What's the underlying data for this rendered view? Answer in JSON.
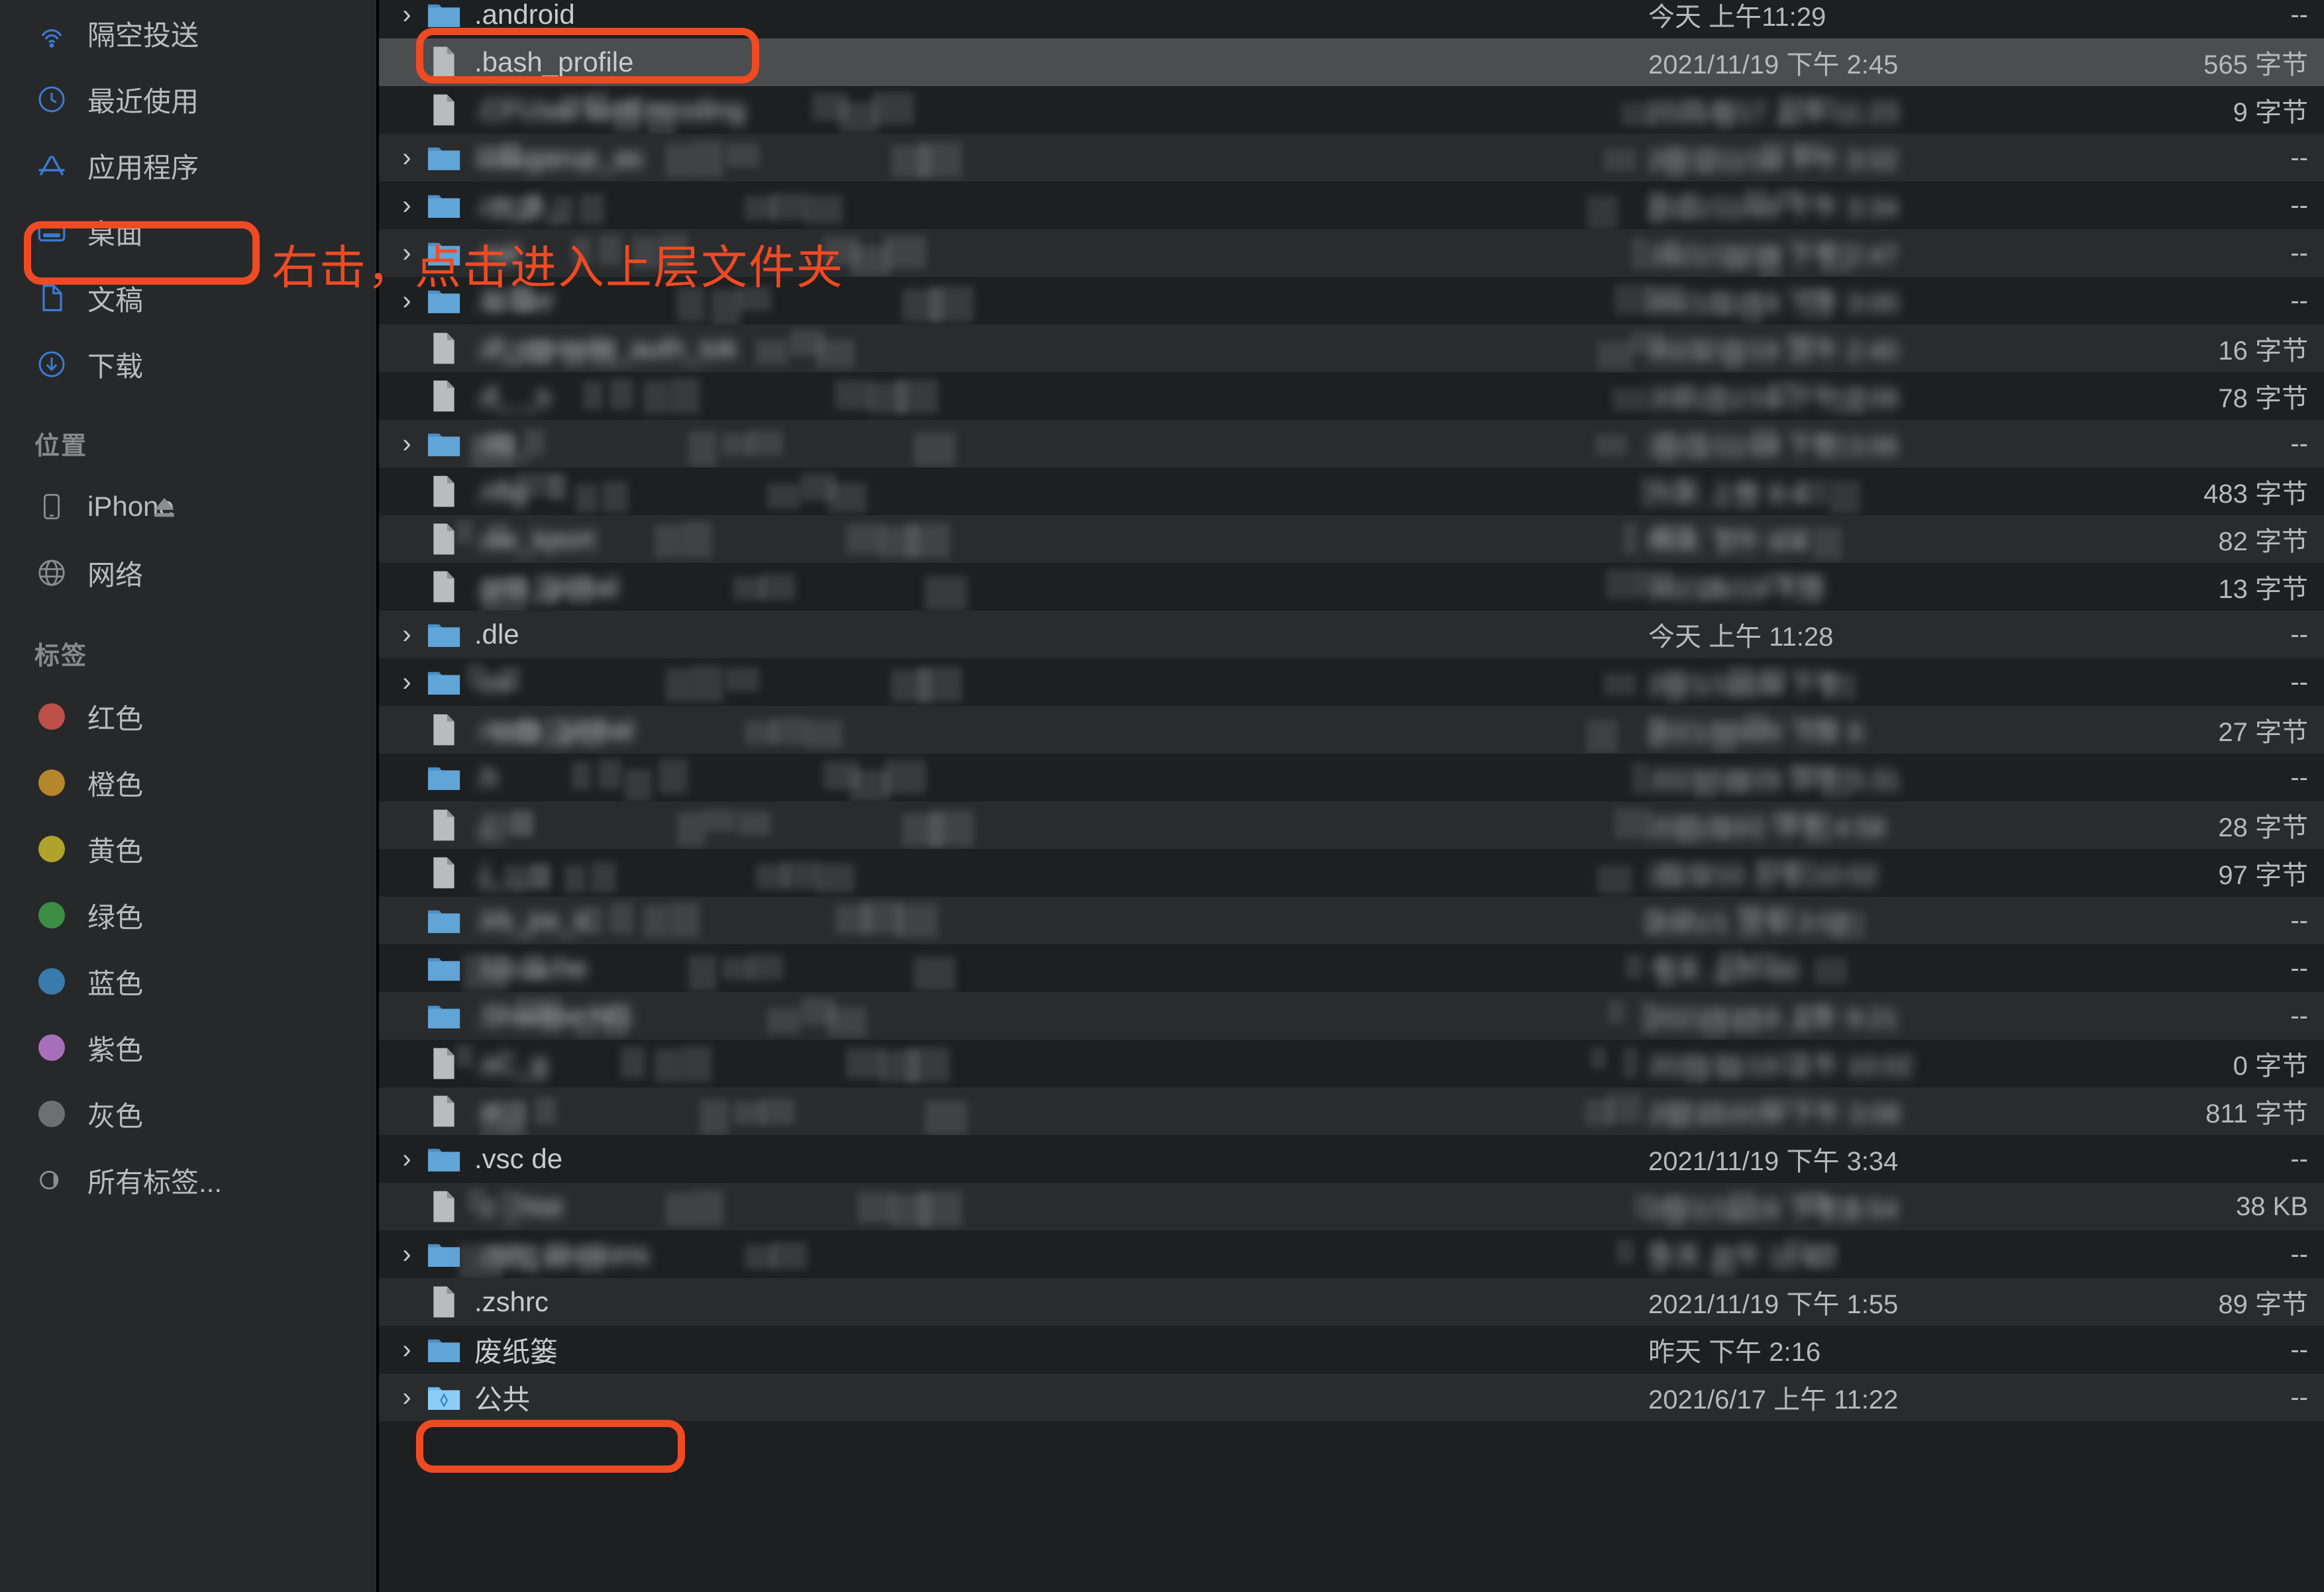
{
  "sidebar": {
    "favorites": [
      {
        "label": "隔空投送",
        "icon": "airdrop-icon"
      },
      {
        "label": "最近使用",
        "icon": "clock-icon"
      },
      {
        "label": "应用程序",
        "icon": "applications-icon"
      },
      {
        "label": "桌面",
        "icon": "desktop-icon"
      },
      {
        "label": "文稿",
        "icon": "document-icon"
      },
      {
        "label": "下载",
        "icon": "download-icon"
      }
    ],
    "locations_title": "位置",
    "locations": [
      {
        "label": "iPhone",
        "icon": "iphone-icon",
        "eject": true
      },
      {
        "label": "网络",
        "icon": "network-globe-icon",
        "eject": false
      }
    ],
    "tags_title": "标签",
    "tags": [
      {
        "label": "红色",
        "color": "#bd5049"
      },
      {
        "label": "橙色",
        "color": "#b5862b"
      },
      {
        "label": "黄色",
        "color": "#b0a32c"
      },
      {
        "label": "绿色",
        "color": "#3c8e45"
      },
      {
        "label": "蓝色",
        "color": "#3a7bad"
      },
      {
        "label": "紫色",
        "color": "#a76fba"
      },
      {
        "label": "灰色",
        "color": "#6e6f71"
      }
    ],
    "all_tags": {
      "label": "所有标签...",
      "icon": "all-tags-icon"
    }
  },
  "annotations": {
    "note_text": "右击，点击进入上层文件夹",
    "accent_color": "#f04a23",
    "highlights": [
      "桌面",
      ".bash_profile",
      ".zshrc"
    ]
  },
  "filelist": {
    "size_placeholder": "--",
    "rows": [
      {
        "name": ".android",
        "date": "今天 上午11:29",
        "size": "--",
        "type": "folder",
        "expandable": true,
        "blur": false,
        "selected": false
      },
      {
        "name": ".bash_profile",
        "date": "2021/11/19 下午 2:45",
        "size": "565 字节",
        "type": "file",
        "expandable": false,
        "blur": false,
        "selected": true
      },
      {
        "name": ".CFUserTextEncoding",
        "date": "2021/6/17 上午 11:23",
        "size": "9 字节",
        "type": "file",
        "expandable": false,
        "blur": true,
        "selected": false
      },
      {
        "name": ".cougarup_as",
        "date": "2021/11/19 下午 3:02",
        "size": "--",
        "type": "folder",
        "expandable": true,
        "blur": true,
        "selected": false
      },
      {
        "name": ".cn_A_",
        "date": "2021/11/19 下午 3:34",
        "size": "--",
        "type": "folder",
        "expandable": true,
        "blur": true,
        "selected": false
      },
      {
        "name": ".nal",
        "date": "2021/11/19 下午 2:47",
        "size": "--",
        "type": "folder",
        "expandable": true,
        "blur": true,
        "selected": false
      },
      {
        "name": ".la Ser",
        "date": "2021/11/19 下午 3:00",
        "size": "--",
        "type": "folder",
        "expandable": true,
        "blur": true,
        "selected": false
      },
      {
        "name": ".dl_console_auth_tok",
        "date": "2021/11/19 下午 2:40",
        "size": "16 字节",
        "type": "file",
        "expandable": false,
        "blur": true,
        "selected": false
      },
      {
        "name": ".d_ _s",
        "date": "2021/11/19 下午 2:09",
        "size": "78 字节",
        "type": "file",
        "expandable": false,
        "blur": true,
        "selected": false
      },
      {
        "name": ".do_",
        "date": "2021/11/19 下午 3:06",
        "size": "--",
        "type": "folder",
        "expandable": true,
        "blur": true,
        "selected": false
      },
      {
        "name": ".nfig",
        "date": "今天 上午 8:4",
        "size": "483 字节",
        "type": "file",
        "expandable": false,
        "blur": true,
        "selected": false
      },
      {
        "name": ".ow_kport",
        "date": "昨天 下午 8:4",
        "size": "82 字节",
        "type": "file",
        "expandable": false,
        "blur": true,
        "selected": false
      },
      {
        "name": ".gno_global",
        "date": "2021/6/19 下午",
        "size": "13 字节",
        "type": "file",
        "expandable": false,
        "blur": true,
        "selected": false
      },
      {
        "name": ".dle",
        "date": "今天 上午 11:28",
        "size": "--",
        "type": "folder",
        "expandable": true,
        "blur": false,
        "selected": false
      },
      {
        "name": ".ov",
        "date": "2021/10/29 下午",
        "size": "--",
        "type": "folder",
        "expandable": true,
        "blur": true,
        "selected": false
      },
      {
        "name": ".node_global",
        "date": "2021/10/29 下午 6",
        "size": "27 字节",
        "type": "file",
        "expandable": false,
        "blur": true,
        "selected": false
      },
      {
        "name": ".h",
        "date": "2021/10/29 下午 5:31",
        "size": "--",
        "type": "folder",
        "expandable": false,
        "blur": true,
        "selected": false
      },
      {
        "name": ".j_",
        "date": "2021/10/2 下午 4:58",
        "size": "28 字节",
        "type": "file",
        "expandable": false,
        "blur": true,
        "selected": false
      },
      {
        "name": ".j_ _",
        "date": "2021/10 上午 10:02",
        "size": "97 字节",
        "type": "file",
        "expandable": false,
        "blur": true,
        "selected": false
      },
      {
        "name": ".lrb_jre_k",
        "date": "2021/1 下午 3:52",
        "size": "--",
        "type": "folder",
        "expandable": false,
        "blur": true,
        "selected": false
      },
      {
        "name": ".lu-cache",
        "date": "今天 上午 00",
        "size": "--",
        "type": "folder",
        "expandable": false,
        "blur": true,
        "selected": false
      },
      {
        "name": ".Shadow NG",
        "date": "2021/11/19 上午 9:21",
        "size": "--",
        "type": "folder",
        "expandable": false,
        "blur": true,
        "selected": false
      },
      {
        "name": ".sC_g",
        "date": "2021/11/19 上午 10:02",
        "size": "0 字节",
        "type": "file",
        "expandable": false,
        "blur": true,
        "selected": false
      },
      {
        "name": ".vi_",
        "date": "2021/10/29 下午 3:08",
        "size": "811 字节",
        "type": "file",
        "expandable": false,
        "blur": true,
        "selected": false
      },
      {
        "name": ".vsc de",
        "date": "2021/11/19 下午 3:34",
        "size": "--",
        "type": "folder",
        "expandable": true,
        "blur": false,
        "selected": false
      },
      {
        "name": ".z _hist",
        "date": "2021/11/19 下午 6:54",
        "size": "38 KB",
        "type": "file",
        "expandable": false,
        "blur": true,
        "selected": false
      },
      {
        "name": ".zsh_sessions",
        "date": "今天 上午 11:47",
        "size": "--",
        "type": "folder",
        "expandable": true,
        "blur": true,
        "selected": false
      },
      {
        "name": ".zshrc",
        "date": "2021/11/19 下午 1:55",
        "size": "89 字节",
        "type": "file",
        "expandable": false,
        "blur": false,
        "selected": false
      },
      {
        "name": "废纸篓",
        "date": "昨天 下午 2:16",
        "size": "--",
        "type": "folder",
        "expandable": true,
        "blur": false,
        "selected": false
      },
      {
        "name": "公共",
        "date": "2021/6/17 上午 11:22",
        "size": "--",
        "type": "folder-public",
        "expandable": true,
        "blur": false,
        "selected": false
      }
    ]
  }
}
